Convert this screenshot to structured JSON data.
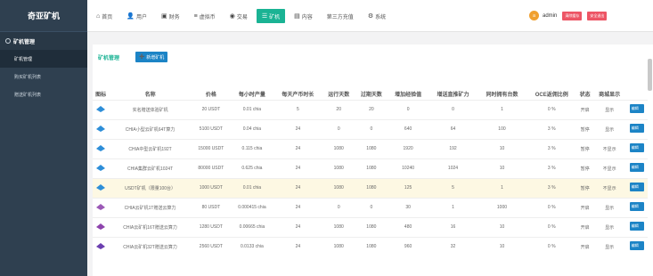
{
  "sidebar": {
    "brand": "奇亚矿机",
    "group": "矿机管理",
    "items": [
      {
        "label": "矿机管理",
        "active": true
      },
      {
        "label": "购买矿机列表",
        "active": false
      },
      {
        "label": "赠送矿机列表",
        "active": false
      }
    ]
  },
  "topnav": {
    "items": [
      {
        "label": "首页",
        "icon": "home-icon",
        "glyph": "⌂"
      },
      {
        "label": "用户",
        "icon": "user-icon",
        "glyph": "👤"
      },
      {
        "label": "财务",
        "icon": "finance-icon",
        "glyph": "▣"
      },
      {
        "label": "虚拟币",
        "icon": "database-icon",
        "glyph": "≡"
      },
      {
        "label": "交易",
        "icon": "exchange-icon",
        "glyph": "◉"
      },
      {
        "label": "矿机",
        "icon": "list-icon",
        "glyph": "☰",
        "active": true
      },
      {
        "label": "内容",
        "icon": "content-icon",
        "glyph": "▤"
      },
      {
        "label": "第三方充值",
        "icon": "",
        "glyph": ""
      },
      {
        "label": "系统",
        "icon": "gear-icon",
        "glyph": "⚙"
      }
    ],
    "user": {
      "avatar_text": "a",
      "name": "admin",
      "clear_cache": "清除缓存",
      "logout": "安全退出"
    }
  },
  "page": {
    "title": "矿机管理",
    "add_button": "新增矿机"
  },
  "table": {
    "headers": [
      "图标",
      "名称",
      "价格",
      "每小时产量",
      "每天产币时长",
      "运行天数",
      "过期天数",
      "增加经验值",
      "增送直推矿力",
      "同时拥有台数",
      "OCE返佣比例",
      "状态",
      "商城显示"
    ],
    "op_label": "编辑",
    "rows": [
      {
        "name": "实名赠送体验矿机",
        "price": "20 USDT",
        "hourly": "0.01 chia",
        "daily_hours": "5",
        "run_days": "20",
        "expire_days": "20",
        "exp": "0",
        "direct_power": "0",
        "count": "1",
        "ratio": "0 %",
        "status": "开启",
        "display": "显示",
        "color": "#2d8ed8"
      },
      {
        "name": "CHIA小型云矿机64T算力",
        "price": "5100 USDT",
        "hourly": "0.04 chia",
        "daily_hours": "24",
        "run_days": "0",
        "expire_days": "0",
        "exp": "640",
        "direct_power": "64",
        "count": "100",
        "ratio": "3 %",
        "status": "暂停",
        "display": "显示",
        "color": "#2d8ed8"
      },
      {
        "name": "CHIA中型云矿机192T",
        "price": "15000 USDT",
        "hourly": "0.115 chia",
        "daily_hours": "24",
        "run_days": "1080",
        "expire_days": "1080",
        "exp": "1920",
        "direct_power": "192",
        "count": "10",
        "ratio": "3 %",
        "status": "暂停",
        "display": "不显示",
        "color": "#2d8ed8"
      },
      {
        "name": "CHIA集群云矿机1024T",
        "price": "80000 USDT",
        "hourly": "0.625 chia",
        "daily_hours": "24",
        "run_days": "1080",
        "expire_days": "1080",
        "exp": "10240",
        "direct_power": "1024",
        "count": "10",
        "ratio": "3 %",
        "status": "暂停",
        "display": "不显示",
        "color": "#2d8ed8"
      },
      {
        "name": "USDT矿机（限量100台）",
        "price": "1000 USDT",
        "hourly": "0.01 chia",
        "daily_hours": "24",
        "run_days": "1080",
        "expire_days": "1080",
        "exp": "125",
        "direct_power": "5",
        "count": "1",
        "ratio": "3 %",
        "status": "暂停",
        "display": "不显示",
        "color": "#2d8ed8",
        "highlight": true
      },
      {
        "name": "CHIA云矿机1T赠送云算力",
        "price": "80 USDT",
        "hourly": "0.000415 chia",
        "daily_hours": "24",
        "run_days": "0",
        "expire_days": "0",
        "exp": "30",
        "direct_power": "1",
        "count": "1000",
        "ratio": "0 %",
        "status": "开启",
        "display": "显示",
        "color": "#9b59b6"
      },
      {
        "name": "CHIA云矿机16T赠送云算力",
        "price": "1280 USDT",
        "hourly": "0.00665 chia",
        "daily_hours": "24",
        "run_days": "1080",
        "expire_days": "1080",
        "exp": "480",
        "direct_power": "16",
        "count": "10",
        "ratio": "0 %",
        "status": "开启",
        "display": "显示",
        "color": "#8e44ad"
      },
      {
        "name": "CHIA云矿机32T赠送云算力",
        "price": "2560 USDT",
        "hourly": "0.0133 chia",
        "daily_hours": "24",
        "run_days": "1080",
        "expire_days": "1080",
        "exp": "960",
        "direct_power": "32",
        "count": "10",
        "ratio": "0 %",
        "status": "开启",
        "display": "显示",
        "color": "#6c3fb0"
      }
    ]
  }
}
